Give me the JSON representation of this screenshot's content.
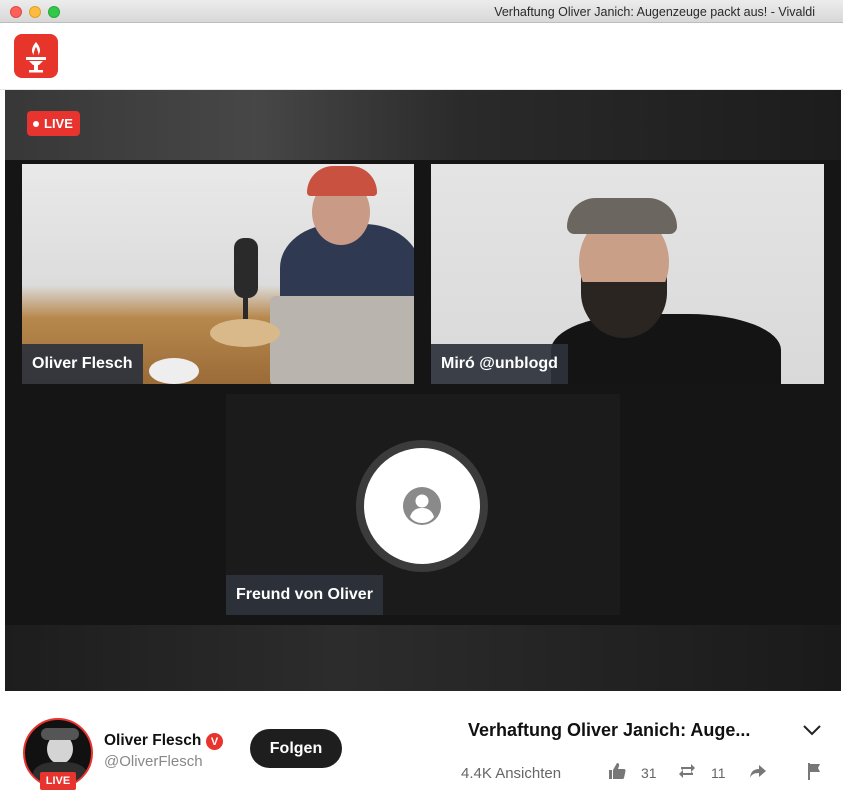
{
  "window": {
    "title": "Verhaftung Oliver Janich: Augenzeuge packt aus! - Vivaldi"
  },
  "player": {
    "live_label": "LIVE",
    "participants": [
      {
        "name": "Oliver Flesch"
      },
      {
        "name": "Miró @unblogd"
      },
      {
        "name": "Freund von Oliver"
      }
    ]
  },
  "channel": {
    "name": "Oliver Flesch",
    "verified_mark": "V",
    "handle": "@OliverFlesch",
    "live_label": "LIVE",
    "follow_label": "Folgen"
  },
  "video": {
    "title": "Verhaftung Oliver Janich: Auge...",
    "views": "4.4K Ansichten",
    "likes": "31",
    "reposts": "11"
  },
  "colors": {
    "brand_red": "#e8352c",
    "dark": "#1e1e1e"
  },
  "icons": [
    "torch-logo-icon",
    "user-placeholder-icon",
    "chevron-down-icon",
    "thumbs-up-icon",
    "repost-icon",
    "share-icon",
    "flag-icon"
  ]
}
